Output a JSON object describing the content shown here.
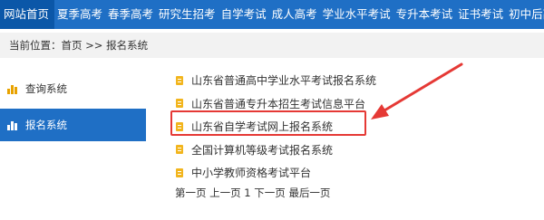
{
  "topnav": {
    "items": [
      "网站首页",
      "夏季高考",
      "春季高考",
      "研究生招考",
      "自学考试",
      "成人高考",
      "学业水平考试",
      "专升本考试",
      "证书考试",
      "初中后高职招生"
    ]
  },
  "breadcrumb": {
    "text": "当前位置：首页 >> 报名系统"
  },
  "sidebar": {
    "items": [
      "查询系统",
      "报名系统"
    ]
  },
  "list": {
    "items": [
      "山东省普通高中学业水平考试报名系统",
      "山东省普通专升本招生考试信息平台",
      "山东省自学考试网上报名系统",
      "全国计算机等级考试报名系统",
      "中小学教师资格考试平台"
    ]
  },
  "pager": {
    "text": "第一页 上一页 1 下一页 最后一页"
  },
  "colors": {
    "nav_bg": "#1f6fc5",
    "active_bg": "#0b57a8",
    "highlight": "#e53935",
    "doc_icon": "#f2b51d"
  },
  "icons": [
    "bar-chart-icon",
    "document-icon",
    "arrow-icon"
  ]
}
